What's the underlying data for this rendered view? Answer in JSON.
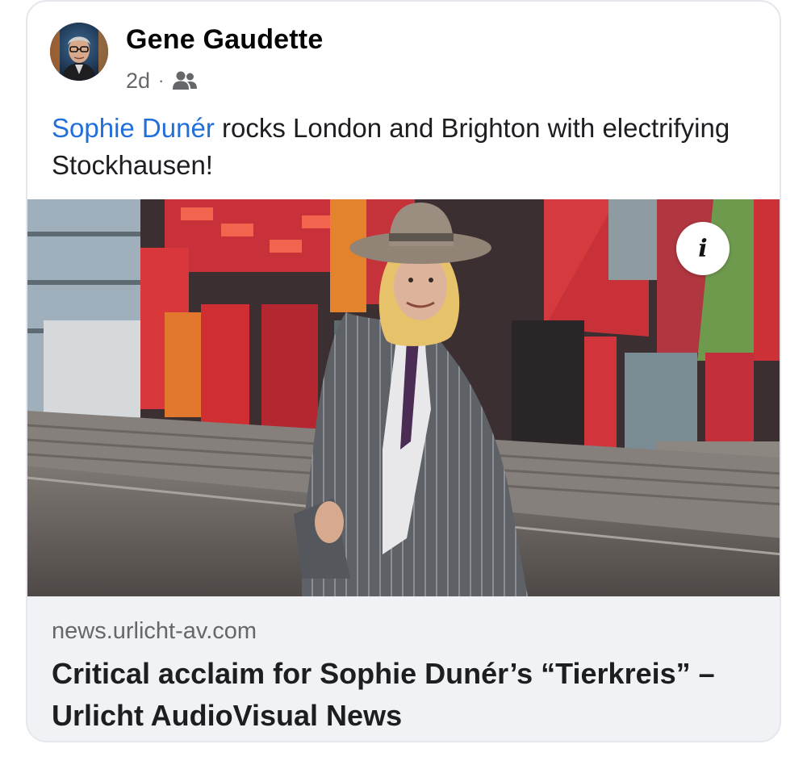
{
  "post": {
    "author": "Gene Gaudette",
    "timestamp": "2d",
    "separator": "·",
    "audience_icon": "friends-icon",
    "text": {
      "mention": "Sophie Dunér",
      "body": " rocks London and Brighton with electrifying Stockhausen!"
    },
    "link_preview": {
      "domain": "news.urlicht-av.com",
      "title": "Critical acclaim for Sophie Dunér’s “Tierkreis” – Urlicht AudioVisual News"
    },
    "info_icon": "info-icon"
  },
  "colors": {
    "mention": "#216fdb",
    "meta_text": "#65676b",
    "link_bg": "#f0f2f5",
    "border": "#e4e6eb"
  }
}
